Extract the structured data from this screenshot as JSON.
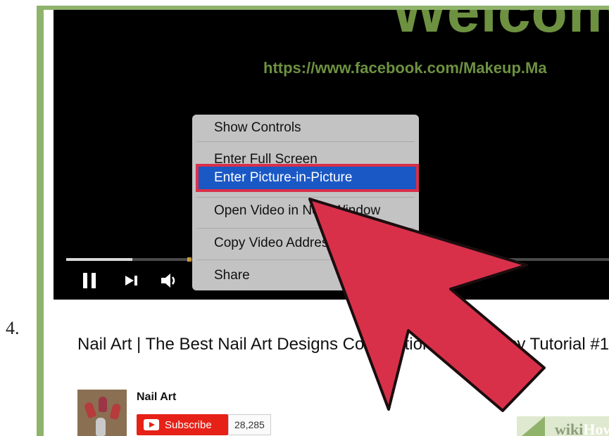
{
  "step_number": "4.",
  "video": {
    "overlay_title": "Welcom",
    "overlay_url": "https://www.facebook.com/Makeup.Ma",
    "progress_fraction": 0.12
  },
  "controls": {
    "pause_icon": "pause-icon",
    "next_icon": "next-track-icon",
    "volume_icon": "volume-icon"
  },
  "context_menu": {
    "items": [
      "Show Controls",
      "Enter Full Screen",
      "Enter Picture-in-Picture",
      "Open Video in New Window",
      "Copy Video Address",
      "Share"
    ],
    "highlighted_index": 2,
    "highlight_color": "#1a58c6",
    "annotation_color": "#d9304a"
  },
  "video_info": {
    "title": "Nail Art | The Best Nail Art Designs Compilation 2016 | Easy Tutorial #1",
    "channel_name": "Nail Art",
    "subscribe_label": "Subscribe",
    "subscriber_count": "28,285"
  },
  "watermark": {
    "prefix": "wiki",
    "suffix": "How"
  },
  "colors": {
    "frame": "#8fb36b",
    "arrow": "#d9304a",
    "subscribe": "#e62117"
  }
}
